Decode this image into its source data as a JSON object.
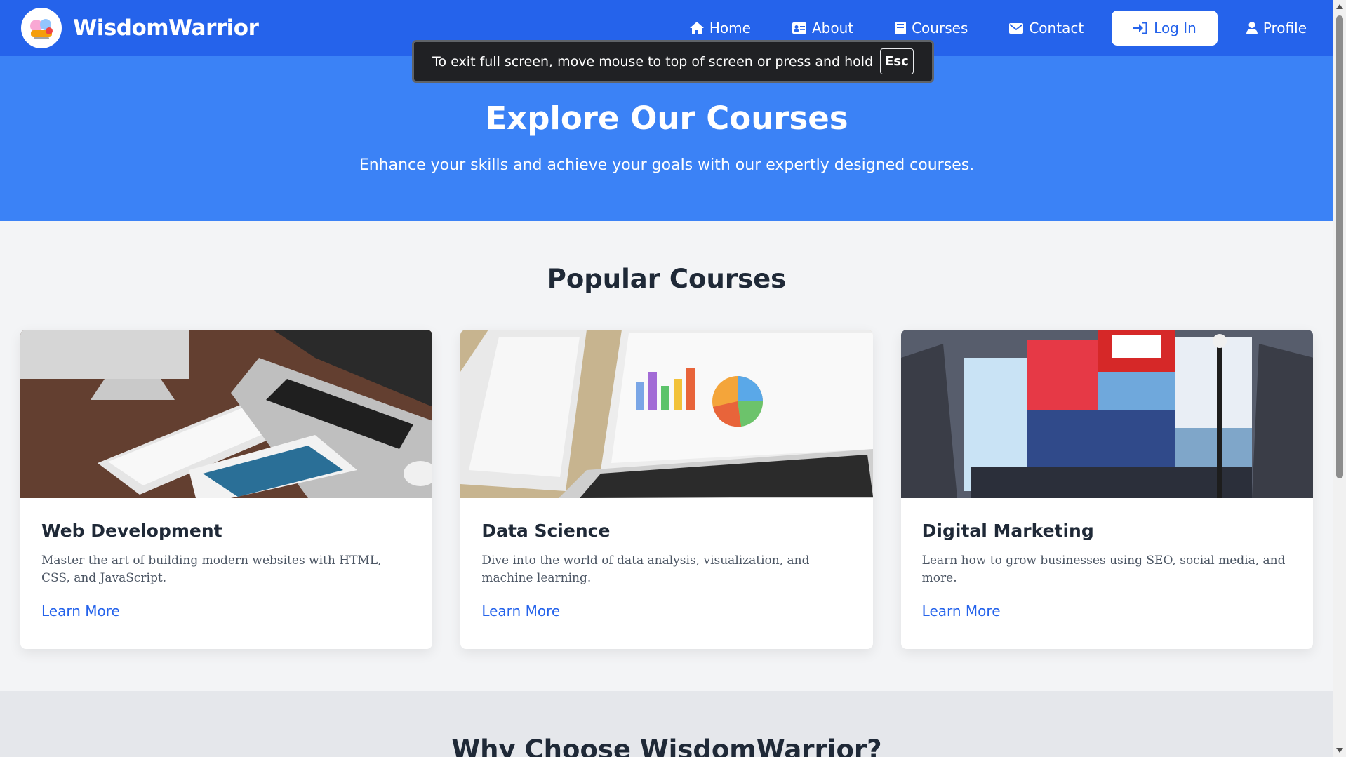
{
  "brand": {
    "name": "WisdomWarrior"
  },
  "nav": {
    "home": "Home",
    "about": "About",
    "courses": "Courses",
    "contact": "Contact",
    "login": "Log In",
    "profile": "Profile"
  },
  "fullscreen_toast": {
    "message": "To exit full screen, move mouse to top of screen or press and hold",
    "key": "Esc"
  },
  "hero": {
    "title": "Explore Our Courses",
    "subtitle": "Enhance your skills and achieve your goals with our expertly designed courses."
  },
  "popular": {
    "title": "Popular Courses",
    "cards": [
      {
        "title": "Web Development",
        "description": "Master the art of building modern websites with HTML, CSS, and JavaScript.",
        "link": "Learn More"
      },
      {
        "title": "Data Science",
        "description": "Dive into the world of data analysis, visualization, and machine learning.",
        "link": "Learn More"
      },
      {
        "title": "Digital Marketing",
        "description": "Learn how to grow businesses using SEO, social media, and more.",
        "link": "Learn More"
      }
    ]
  },
  "why": {
    "title": "Why Choose WisdomWarrior?"
  },
  "colors": {
    "navbar": "#2563eb",
    "hero": "#3b82f6",
    "link": "#2563eb",
    "page_bg": "#f3f4f6"
  }
}
